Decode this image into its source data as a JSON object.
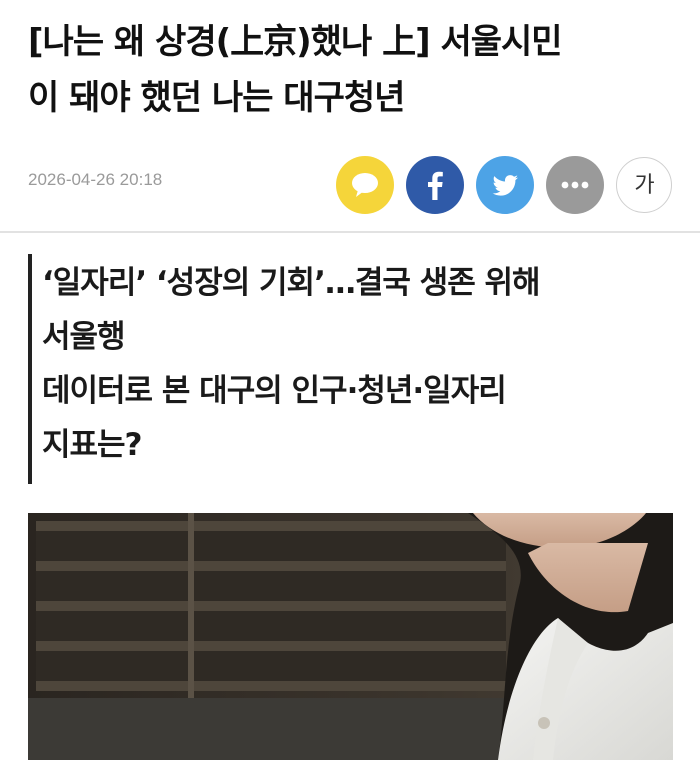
{
  "article": {
    "headline_lines": [
      "[나는 왜 상경(上京)했나 上] 서울시민",
      "이 돼야 했던 나는 대구청년"
    ],
    "date": "2026-04-26 20:18",
    "subtitle_lines": [
      "‘일자리’ ‘성장의 기회’…결국 생존 위해",
      "서울행",
      "데이터로 본 대구의 인구·청년·일자리",
      "지표는?"
    ]
  },
  "share_bar": {
    "buttons": [
      {
        "name": "kakaotalk",
        "icon": "speech-bubble-icon",
        "color": "#f5d53a"
      },
      {
        "name": "facebook",
        "icon": "facebook-icon",
        "color": "#2f5aa8"
      },
      {
        "name": "twitter",
        "icon": "twitter-icon",
        "color": "#4da3e6"
      },
      {
        "name": "more",
        "icon": "more-dots-icon",
        "color": "#9a9a9a"
      }
    ],
    "font_size_label": "가"
  }
}
